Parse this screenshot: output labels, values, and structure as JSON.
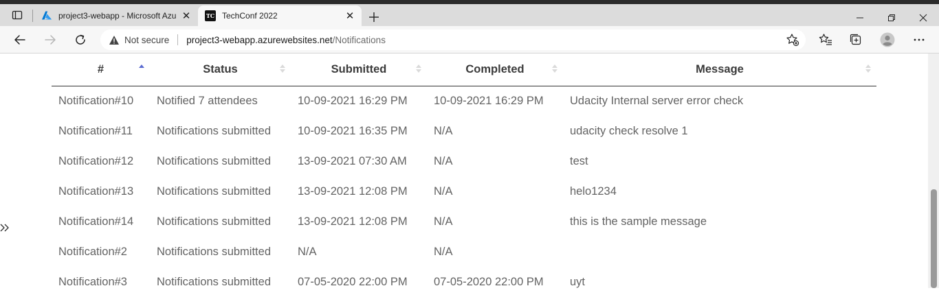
{
  "browser": {
    "tabs": [
      {
        "title": "project3-webapp - Microsoft Azu",
        "favicon": "azure-icon",
        "active": false
      },
      {
        "title": "TechConf 2022",
        "favicon": "techconf-icon",
        "favicon_text": "TC",
        "active": true
      }
    ],
    "address": {
      "security_label": "Not secure",
      "host": "project3-webapp.azurewebsites.net",
      "path": "/Notifications"
    },
    "colors": {
      "azure_brand": "#0078d4",
      "sort_active": "#5b6bd1"
    }
  },
  "notifications": {
    "columns": [
      "#",
      "Status",
      "Submitted",
      "Completed",
      "Message"
    ],
    "rows": [
      {
        "id": "Notification#10",
        "status": "Notified 7 attendees",
        "submitted": "10-09-2021 16:29 PM",
        "completed": "10-09-2021 16:29 PM",
        "message": "Udacity Internal server error check"
      },
      {
        "id": "Notification#11",
        "status": "Notifications submitted",
        "submitted": "10-09-2021 16:35 PM",
        "completed": "N/A",
        "message": "udacity check resolve 1"
      },
      {
        "id": "Notification#12",
        "status": "Notifications submitted",
        "submitted": "13-09-2021 07:30 AM",
        "completed": "N/A",
        "message": "test"
      },
      {
        "id": "Notification#13",
        "status": "Notifications submitted",
        "submitted": "13-09-2021 12:08 PM",
        "completed": "N/A",
        "message": "helo1234"
      },
      {
        "id": "Notification#14",
        "status": "Notifications submitted",
        "submitted": "13-09-2021 12:08 PM",
        "completed": "N/A",
        "message": "this is the sample message"
      },
      {
        "id": "Notification#2",
        "status": "Notifications submitted",
        "submitted": "N/A",
        "completed": "N/A",
        "message": ""
      },
      {
        "id": "Notification#3",
        "status": "Notifications submitted",
        "submitted": "07-05-2020 22:00 PM",
        "completed": "07-05-2020 22:00 PM",
        "message": "uyt"
      }
    ]
  }
}
